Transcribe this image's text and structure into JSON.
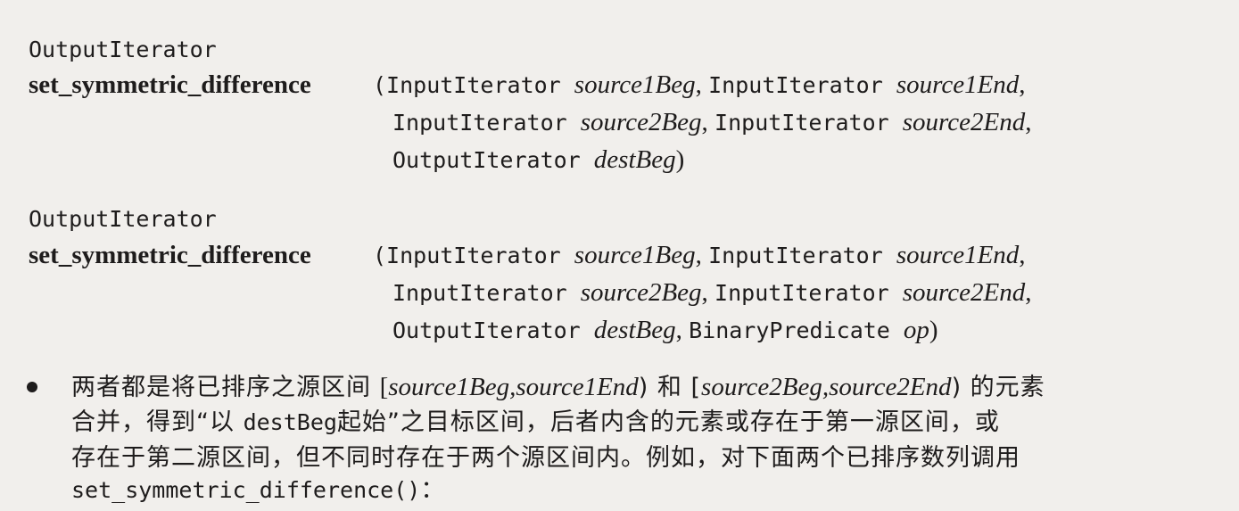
{
  "sig1": {
    "ret": "OutputIterator",
    "name": "set_symmetric_difference",
    "l1": [
      {
        "t": "(InputIterator ",
        "s": "mono"
      },
      {
        "t": "source1Beg",
        "s": "it"
      },
      {
        "t": ", ",
        "s": "serif"
      },
      {
        "t": "InputIterator ",
        "s": "mono"
      },
      {
        "t": "source1End",
        "s": "it"
      },
      {
        "t": ",",
        "s": "serif"
      }
    ],
    "l2": [
      {
        "t": "InputIterator ",
        "s": "mono"
      },
      {
        "t": "source2Beg",
        "s": "it"
      },
      {
        "t": ", ",
        "s": "serif"
      },
      {
        "t": "InputIterator ",
        "s": "mono"
      },
      {
        "t": "source2End",
        "s": "it"
      },
      {
        "t": ",",
        "s": "serif"
      }
    ],
    "l3": [
      {
        "t": "OutputIterator ",
        "s": "mono"
      },
      {
        "t": "destBeg",
        "s": "it"
      },
      {
        "t": ")",
        "s": "serif"
      }
    ]
  },
  "sig2": {
    "ret": "OutputIterator",
    "name": "set_symmetric_difference",
    "l1": [
      {
        "t": "(InputIterator ",
        "s": "mono"
      },
      {
        "t": "source1Beg",
        "s": "it"
      },
      {
        "t": ", ",
        "s": "serif"
      },
      {
        "t": "InputIterator ",
        "s": "mono"
      },
      {
        "t": "source1End",
        "s": "it"
      },
      {
        "t": ",",
        "s": "serif"
      }
    ],
    "l2": [
      {
        "t": "InputIterator ",
        "s": "mono"
      },
      {
        "t": "source2Beg",
        "s": "it"
      },
      {
        "t": ", ",
        "s": "serif"
      },
      {
        "t": "InputIterator ",
        "s": "mono"
      },
      {
        "t": "source2End",
        "s": "it"
      },
      {
        "t": ",",
        "s": "serif"
      }
    ],
    "l3": [
      {
        "t": "OutputIterator ",
        "s": "mono"
      },
      {
        "t": "destBeg",
        "s": "it"
      },
      {
        "t": ", ",
        "s": "serif"
      },
      {
        "t": "BinaryPredicate ",
        "s": "mono"
      },
      {
        "t": "op",
        "s": "it"
      },
      {
        "t": ")",
        "s": "serif"
      }
    ]
  },
  "bullet": {
    "l1": [
      {
        "t": "两者都是将已排序之源区间 ",
        "s": "cjk"
      },
      {
        "t": "[",
        "s": "serif"
      },
      {
        "t": "source1Beg,source1End",
        "s": "it"
      },
      {
        "t": ") 和 [",
        "s": "cjkserif"
      },
      {
        "t": "source2Beg,source2End",
        "s": "it"
      },
      {
        "t": ") 的元素",
        "s": "cjkserif"
      }
    ],
    "l2": [
      {
        "t": "合并，得到“以 ",
        "s": "cjk"
      },
      {
        "t": "destBeg",
        "s": "mono"
      },
      {
        "t": "起始”之目标区间，后者内含的元素或存在于第一源区间，或",
        "s": "cjk"
      }
    ],
    "l3": [
      {
        "t": "存在于第二源区间，但不同时存在于两个源区间内。例如，对下面两个已排序数列调用",
        "s": "cjk"
      }
    ],
    "l4": [
      {
        "t": "set_symmetric_difference()",
        "s": "mono"
      },
      {
        "t": "：",
        "s": "cjk"
      }
    ]
  }
}
